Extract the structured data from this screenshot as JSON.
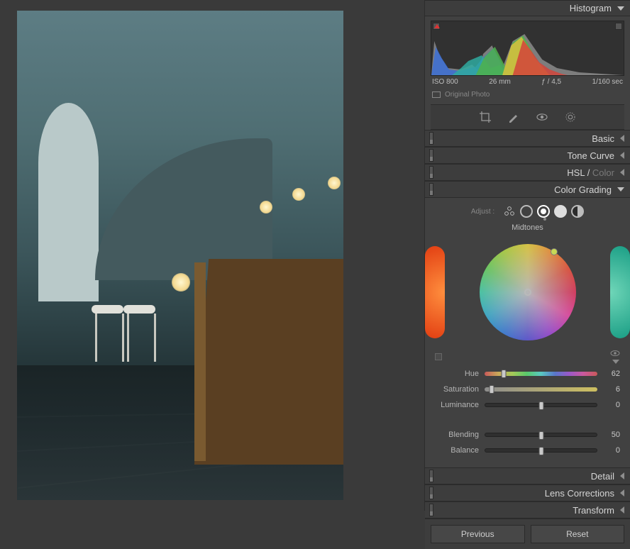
{
  "histogram_panel": {
    "title": "Histogram"
  },
  "meta": {
    "iso": "ISO 800",
    "focal": "26 mm",
    "aperture": "ƒ / 4,5",
    "shutter": "1/160 sec"
  },
  "original_label": "Original Photo",
  "panels": {
    "basic": "Basic",
    "tone_curve": "Tone Curve",
    "hsl": "HSL",
    "hsl_sub": "Color",
    "color_grading": "Color Grading",
    "detail": "Detail",
    "lens": "Lens Corrections",
    "transform": "Transform"
  },
  "cg": {
    "adjust_label": "Adjust :",
    "mode": "Midtones",
    "hue_label": "Hue",
    "hue": 62,
    "hue_pct": 17,
    "sat_label": "Saturation",
    "sat": 6,
    "sat_pct": 6,
    "lum_label": "Luminance",
    "lum": 0,
    "lum_pct": 50,
    "blend_label": "Blending",
    "blend": 50,
    "blend_pct": 50,
    "bal_label": "Balance",
    "bal": 0,
    "bal_pct": 50
  },
  "footer": {
    "prev": "Previous",
    "reset": "Reset"
  }
}
